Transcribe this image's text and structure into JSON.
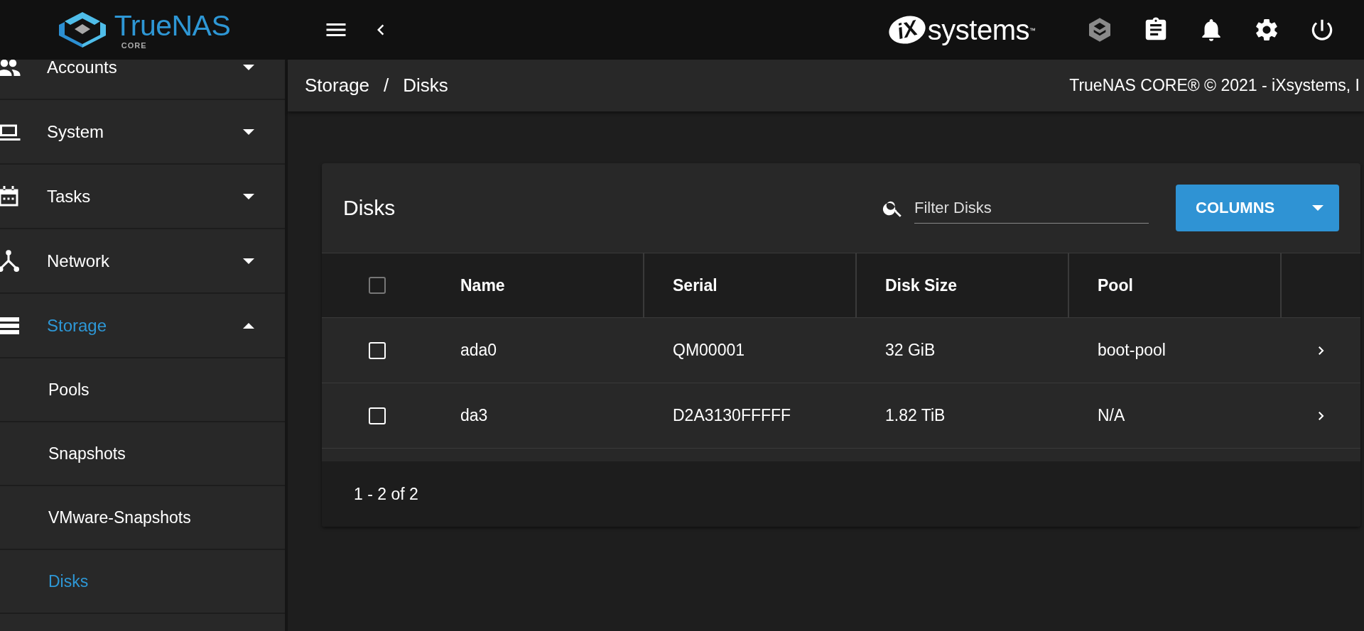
{
  "header": {
    "logo": {
      "name": "TrueNAS",
      "edition": "CORE"
    },
    "vendor": {
      "mark": "iX",
      "name": "systems",
      "trademark": "™"
    }
  },
  "sidebar": {
    "items": [
      {
        "label": "Accounts",
        "selected": false,
        "expanded": false
      },
      {
        "label": "System",
        "selected": false,
        "expanded": false
      },
      {
        "label": "Tasks",
        "selected": false,
        "expanded": false
      },
      {
        "label": "Network",
        "selected": false,
        "expanded": false
      },
      {
        "label": "Storage",
        "selected": true,
        "expanded": true,
        "children": [
          {
            "label": "Pools",
            "selected": false
          },
          {
            "label": "Snapshots",
            "selected": false
          },
          {
            "label": "VMware-Snapshots",
            "selected": false
          },
          {
            "label": "Disks",
            "selected": true
          }
        ]
      }
    ]
  },
  "breadcrumb": {
    "items": [
      "Storage",
      "Disks"
    ],
    "separator": "/"
  },
  "copyright": "TrueNAS CORE® © 2021 - iXsystems, I",
  "card": {
    "title": "Disks",
    "filter": {
      "placeholder": "Filter Disks"
    },
    "columns_button": "COLUMNS",
    "table": {
      "select_all": {
        "checked": false
      },
      "columns": [
        "Name",
        "Serial",
        "Disk Size",
        "Pool"
      ],
      "rows": [
        {
          "checked": false,
          "cells": [
            "ada0",
            "QM00001",
            "32 GiB",
            "boot-pool"
          ]
        },
        {
          "checked": false,
          "cells": [
            "da3",
            "D2A3130FFFFF",
            "1.82 TiB",
            "N/A"
          ]
        }
      ]
    },
    "pagination": "1 - 2 of 2"
  }
}
